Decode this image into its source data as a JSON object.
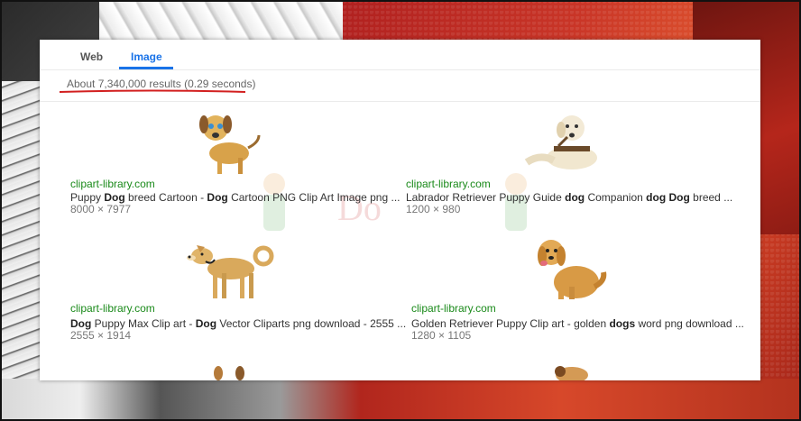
{
  "tabs": [
    {
      "label": "Web",
      "active": false
    },
    {
      "label": "Image",
      "active": true
    }
  ],
  "stats": "About 7,340,000 results (0.29 seconds)",
  "colors": {
    "accent": "#1a73e8",
    "url_green": "#1a8a1a",
    "annotation_red": "#d21f1f"
  },
  "results": [
    {
      "source": "clipart-library.com",
      "title_parts": [
        "Puppy ",
        "Dog",
        " breed Cartoon - ",
        "Dog",
        " Cartoon PNG Clip Art Image png ..."
      ],
      "dims": "8000 × 7977",
      "icon": "beagle-puppy-image"
    },
    {
      "source": "clipart-library.com",
      "title_parts": [
        "Labrador Retriever Puppy Guide ",
        "dog",
        " Companion ",
        "dog",
        " ",
        "Dog",
        " breed ..."
      ],
      "dims": "1200 × 980",
      "icon": "labrador-image"
    },
    {
      "source": "clipart-library.com",
      "title_parts": [
        "Dog",
        " Puppy Max Clip art - ",
        "Dog",
        " Vector Cliparts png download - 2555 ..."
      ],
      "dims": "2555 × 1914",
      "icon": "shiba-dog-image"
    },
    {
      "source": "clipart-library.com",
      "title_parts": [
        "Golden Retriever Puppy Clip art - golden ",
        "dogs",
        " word png download ..."
      ],
      "dims": "1280 × 1105",
      "icon": "golden-retriever-image"
    }
  ]
}
